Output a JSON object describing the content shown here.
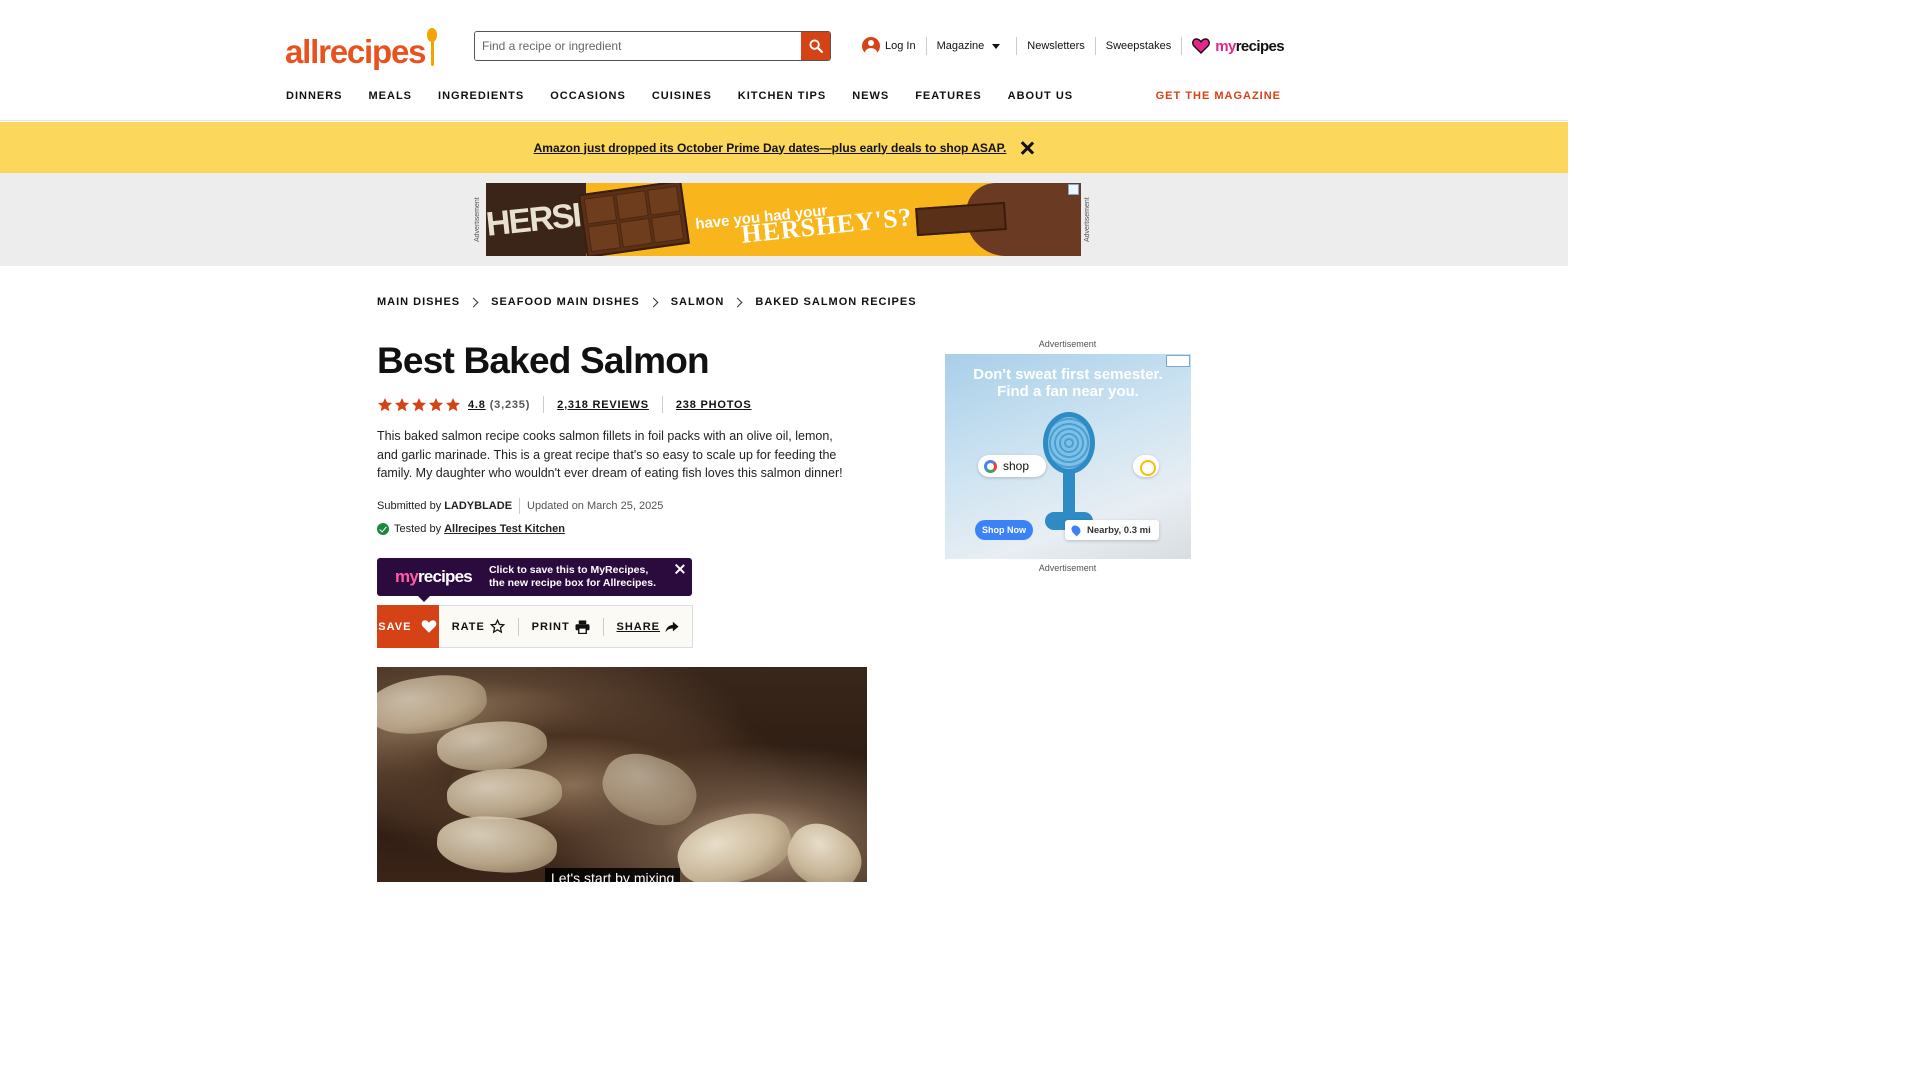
{
  "header": {
    "logo_text": "allrecipes",
    "search_placeholder": "Find a recipe or ingredient",
    "login_label": "Log In",
    "magazine_label": "Magazine",
    "newsletters_label": "Newsletters",
    "sweepstakes_label": "Sweepstakes",
    "myrecipes_my": "my",
    "myrecipes_rec": "recipes",
    "nav": [
      "DINNERS",
      "MEALS",
      "INGREDIENTS",
      "OCCASIONS",
      "CUISINES",
      "KITCHEN TIPS",
      "NEWS",
      "FEATURES",
      "ABOUT US"
    ],
    "get_magazine": "GET THE MAGAZINE"
  },
  "promo": {
    "text": "Amazon just dropped its October Prime Day dates—plus early deals to shop ASAP."
  },
  "top_ad": {
    "label": "Advertisement",
    "small_text": "have you had your",
    "brand_text": "HERSHEY'S?",
    "wrapper_text": "HERSI"
  },
  "breadcrumb": [
    "MAIN DISHES",
    "SEAFOOD MAIN DISHES",
    "SALMON",
    "BAKED SALMON RECIPES"
  ],
  "recipe": {
    "title": "Best Baked Salmon",
    "rating": "4.8",
    "rating_count": "(3,235)",
    "stars": 5,
    "reviews": "2,318 REVIEWS",
    "photos": "238 PHOTOS",
    "description": "This baked salmon recipe cooks salmon fillets in foil packs with an olive oil, lemon, and garlic marinade. This is a great recipe that's so easy to scale up for feeding the family. My daughter who wouldn't ever dream of eating fish loves this salmon dinner!",
    "submitted_prefix": "Submitted by",
    "author": "LADYBLADE",
    "updated": "Updated on March 25, 2025",
    "tested_prefix": "Tested by",
    "tested_by": "Allrecipes Test Kitchen"
  },
  "myrecipes_tip": {
    "logo_my": "my",
    "logo_rec": "recipes",
    "line1": "Click to save this to MyRecipes,",
    "line2": "the new recipe box for Allrecipes."
  },
  "actions": {
    "save": "SAVE",
    "rate": "RATE",
    "print": "PRINT",
    "share": "SHARE"
  },
  "video": {
    "caption": "Let's start by mixing"
  },
  "side_ad": {
    "label_top": "Advertisement",
    "label_bottom": "Advertisement",
    "headline_1": "Don't sweat first semester.",
    "headline_2": "Find a fan near you.",
    "shop_label": "shop",
    "shop_now": "Shop Now",
    "nearby": "Nearby, 0.3 mi"
  },
  "colors": {
    "brand_orange": "#d54215",
    "promo_yellow": "#fbd75c",
    "star_orange": "#d54215",
    "myrecipes_pink": "#e4268b"
  }
}
